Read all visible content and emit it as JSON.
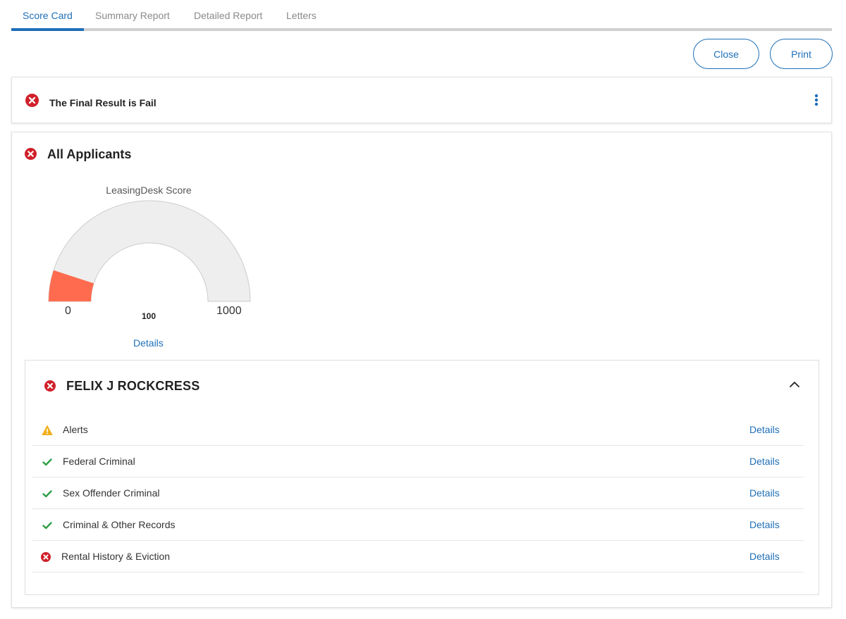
{
  "tabs": [
    {
      "label": "Score Card",
      "active": true
    },
    {
      "label": "Summary Report",
      "active": false
    },
    {
      "label": "Detailed Report",
      "active": false
    },
    {
      "label": "Letters",
      "active": false
    }
  ],
  "actions": {
    "close_label": "Close",
    "print_label": "Print"
  },
  "result": {
    "text": "The Final Result is Fail",
    "status": "fail",
    "icon": "fail-circle-icon",
    "menu_icon": "kebab-menu-icon"
  },
  "applicants_section": {
    "title": "All Applicants",
    "status": "fail",
    "gauge": {
      "title": "LeasingDesk Score",
      "min_label": "0",
      "max_label": "1000",
      "value_label": "100",
      "min": 0,
      "max": 1000,
      "value": 100,
      "details_label": "Details"
    }
  },
  "applicant": {
    "name": "FELIX J ROCKCRESS",
    "status": "fail",
    "expanded": true,
    "checks": [
      {
        "label": "Alerts",
        "status": "warning",
        "icon": "warning-icon",
        "link": "Details"
      },
      {
        "label": "Federal Criminal",
        "status": "pass",
        "icon": "check-icon",
        "link": "Details"
      },
      {
        "label": "Sex Offender Criminal",
        "status": "pass",
        "icon": "check-icon",
        "link": "Details"
      },
      {
        "label": "Criminal & Other Records",
        "status": "pass",
        "icon": "check-icon",
        "link": "Details"
      },
      {
        "label": "Rental History & Eviction",
        "status": "fail",
        "icon": "fail-circle-icon",
        "link": "Details"
      }
    ]
  },
  "colors": {
    "accent": "#1f6fb8",
    "fail": "#d0202a",
    "pass": "#2f9e44",
    "warning": "#f2b01e",
    "gauge_fill": "#ff6b4f",
    "gauge_track": "#eeeeee"
  }
}
